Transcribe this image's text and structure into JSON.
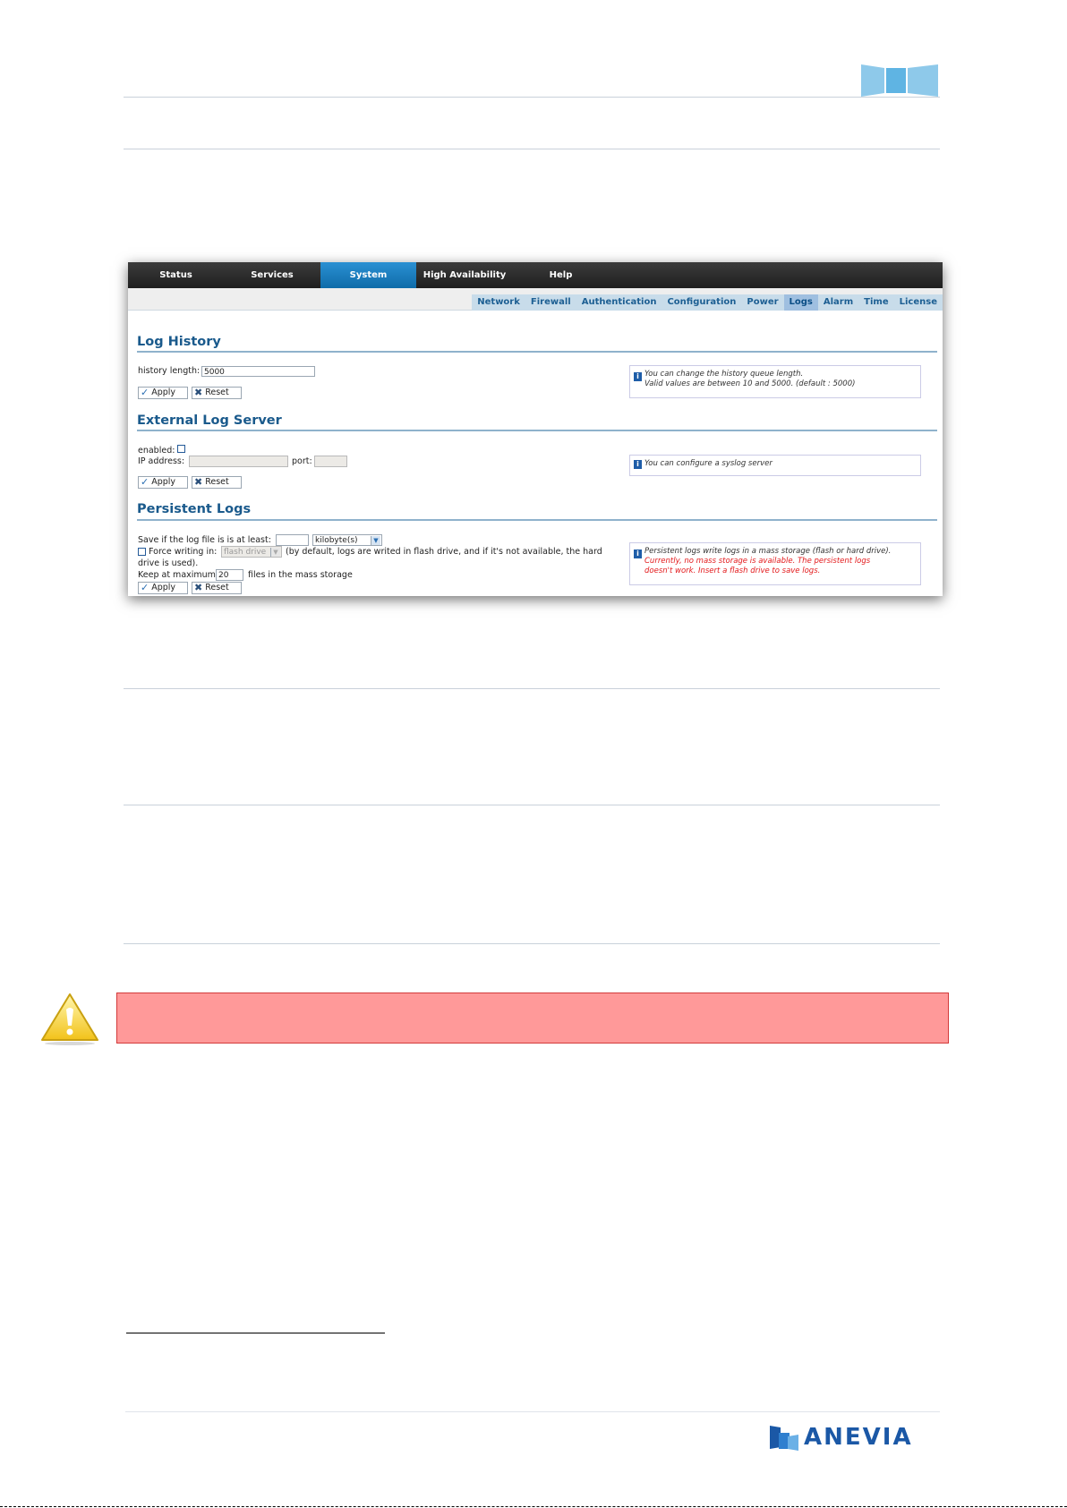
{
  "colors": {
    "accent_blue": "#1a5a8c",
    "nav_active": "#1b84c6",
    "warning_bg": "#ff9999",
    "brand_blue": "#1b58a6",
    "note_red": "#e3191b"
  },
  "nav": {
    "tabs": [
      {
        "label": "Status",
        "active": false
      },
      {
        "label": "Services",
        "active": false
      },
      {
        "label": "System",
        "active": true
      },
      {
        "label": "High Availability",
        "active": false
      },
      {
        "label": "Help",
        "active": false
      }
    ],
    "subtabs": [
      {
        "label": "Network",
        "active": false
      },
      {
        "label": "Firewall",
        "active": false
      },
      {
        "label": "Authentication",
        "active": false
      },
      {
        "label": "Configuration",
        "active": false
      },
      {
        "label": "Power",
        "active": false
      },
      {
        "label": "Logs",
        "active": true
      },
      {
        "label": "Alarm",
        "active": false
      },
      {
        "label": "Time",
        "active": false
      },
      {
        "label": "License",
        "active": false
      }
    ]
  },
  "log_history": {
    "title": "Log History",
    "length_label": "history length:",
    "length_value": "5000",
    "apply": "Apply",
    "reset": "Reset",
    "info_line1": "You can change the history queue length.",
    "info_line2": "Valid values are between 10 and 5000. (default : 5000)"
  },
  "external_log_server": {
    "title": "External Log Server",
    "enabled_label": "enabled:",
    "enabled_checked": false,
    "ip_label": "IP address:",
    "ip_value": "",
    "port_label": "port:",
    "port_value": "",
    "apply": "Apply",
    "reset": "Reset",
    "info": "You can configure a syslog server"
  },
  "persistent_logs": {
    "title": "Persistent Logs",
    "save_label": "Save if the log file is is at least:",
    "size_value": "",
    "unit_value": "kilobyte(s)",
    "force_label": "Force writing in:",
    "force_checked": false,
    "force_target": "flash drive",
    "force_note_1": "(by default, logs are writed in flash drive, and if it's not available, the hard",
    "force_note_2": "drive is used).",
    "keep_label": "Keep at maximum:",
    "keep_value": "20",
    "keep_suffix": "files in the mass storage",
    "apply": "Apply",
    "reset": "Reset",
    "info_line1": "Persistent logs write logs in a mass storage (flash or hard drive).",
    "info_line2": "Currently, no mass storage is available. The persistent logs",
    "info_line3": "doesn't work. Insert a flash drive to save logs."
  },
  "footer": {
    "brand": "ANEVIA"
  }
}
